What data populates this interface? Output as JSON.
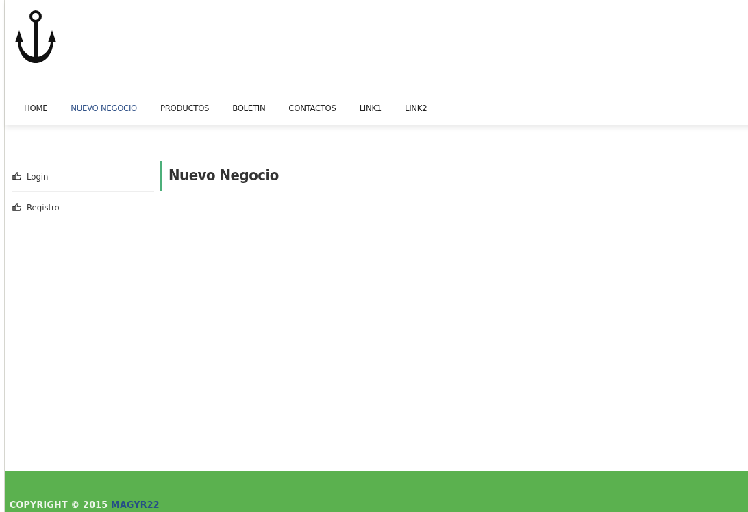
{
  "nav": [
    {
      "label": "HOME",
      "selected": false
    },
    {
      "label": "NUEVO NEGOCIO",
      "selected": true
    },
    {
      "label": "PRODUCTOS",
      "selected": false
    },
    {
      "label": "BOLETIN",
      "selected": false
    },
    {
      "label": "CONTACTOS",
      "selected": false
    },
    {
      "label": "LINK1",
      "selected": false
    },
    {
      "label": "LINK2",
      "selected": false
    }
  ],
  "sidebar": {
    "items": [
      "Login",
      "Registro"
    ]
  },
  "heading": "Nuevo Negocio",
  "footer": {
    "text": "COPYRIGHT © 2015",
    "link": "MAGYR22"
  }
}
